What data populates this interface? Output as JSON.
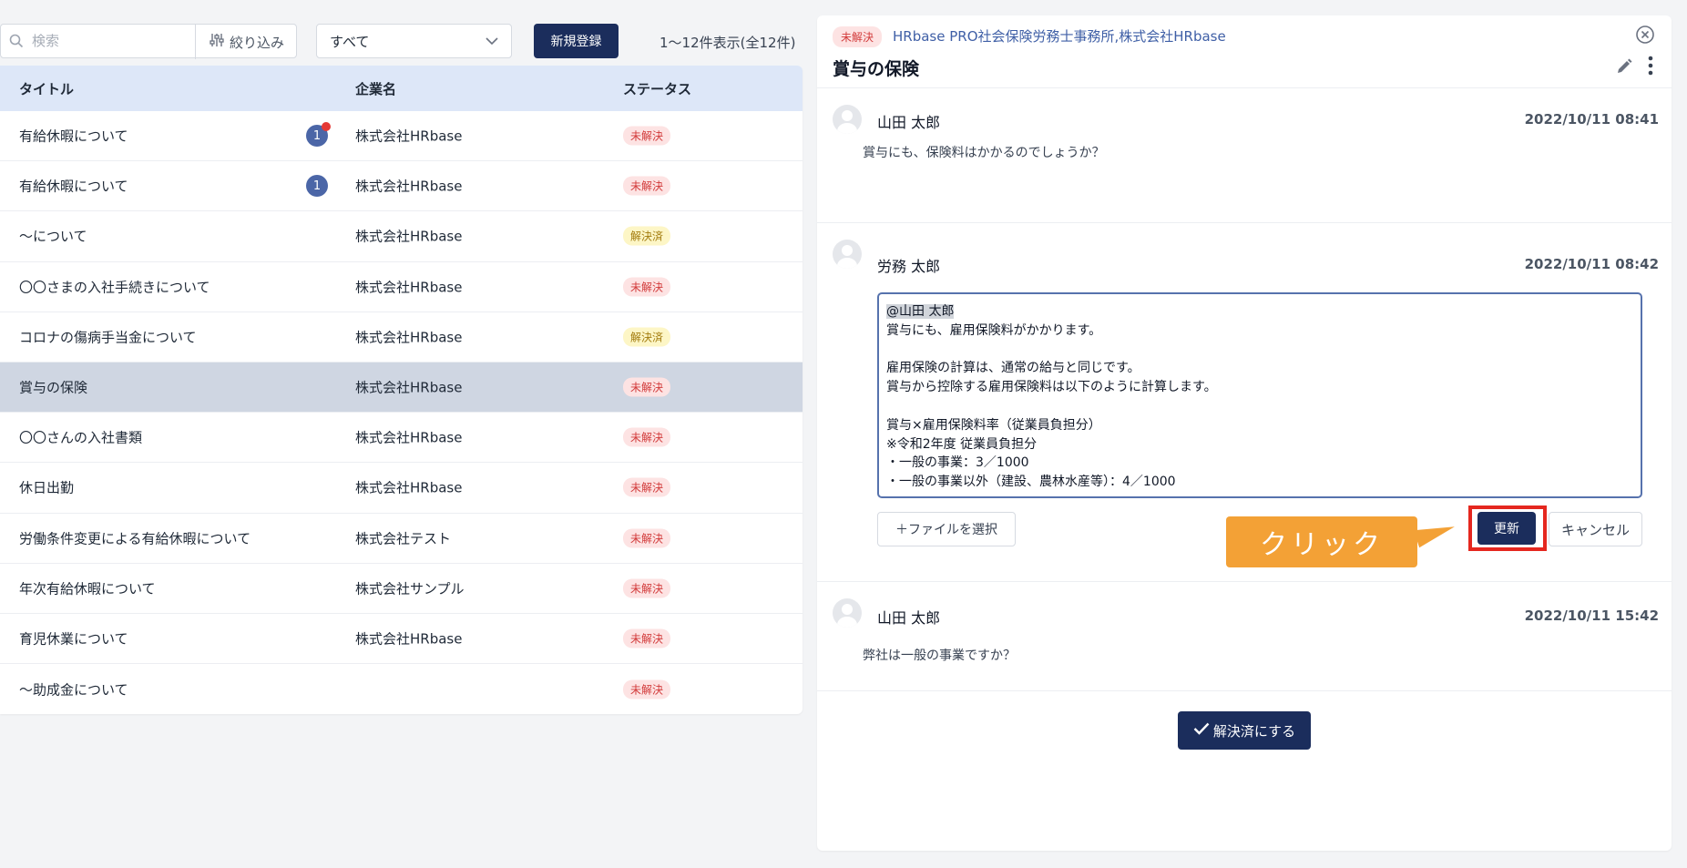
{
  "toolbar": {
    "search_placeholder": "検索",
    "filter_label": "絞り込み",
    "select_value": "すべて",
    "new_label": "新規登録",
    "count_text": "1～12件表示(全12件)"
  },
  "table": {
    "headers": {
      "title": "タイトル",
      "company": "企業名",
      "status": "ステータス"
    },
    "rows": [
      {
        "title": "有給休暇について",
        "company": "株式会社HRbase",
        "status": "未解決",
        "unread": "1",
        "dot": true
      },
      {
        "title": "有給休暇について",
        "company": "株式会社HRbase",
        "status": "未解決",
        "unread": "1",
        "dot": false
      },
      {
        "title": "〜について",
        "company": "株式会社HRbase",
        "status": "解決済"
      },
      {
        "title": "〇〇さまの入社手続きについて",
        "company": "株式会社HRbase",
        "status": "未解決"
      },
      {
        "title": "コロナの傷病手当金について",
        "company": "株式会社HRbase",
        "status": "解決済"
      },
      {
        "title": "賞与の保険",
        "company": "株式会社HRbase",
        "status": "未解決",
        "selected": true
      },
      {
        "title": "〇〇さんの入社書類",
        "company": "株式会社HRbase",
        "status": "未解決"
      },
      {
        "title": "休日出勤",
        "company": "株式会社HRbase",
        "status": "未解決"
      },
      {
        "title": "労働条件変更による有給休暇について",
        "company": "株式会社テスト",
        "status": "未解決"
      },
      {
        "title": "年次有給休暇について",
        "company": "株式会社サンプル",
        "status": "未解決"
      },
      {
        "title": "育児休業について",
        "company": "株式会社HRbase",
        "status": "未解決"
      },
      {
        "title": "〜助成金について",
        "company": "",
        "status": "未解決"
      }
    ]
  },
  "detail": {
    "status": "未解決",
    "org": "HRbase PRO社会保険労務士事務所,株式会社HRbase",
    "title": "賞与の保険",
    "messages": [
      {
        "name": "山田 太郎",
        "time": "2022/10/11 08:41",
        "body": "賞与にも、保険料はかかるのでしょうか？"
      },
      {
        "name": "労務 太郎",
        "time": "2022/10/11 08:42"
      },
      {
        "name": "山田 太郎",
        "time": "2022/10/11 15:42",
        "body": "弊社は一般の事業ですか？"
      }
    ],
    "reply": {
      "mention": "@山田 太郎",
      "lines": [
        "賞与にも、雇用保険料がかかります。",
        "",
        "雇用保険の計算は、通常の給与と同じです。",
        "賞与から控除する雇用保険料は以下のように計算します。",
        "",
        "賞与×雇用保険料率（従業員負担分）",
        "※令和2年度 従業員負担分",
        "・一般の事業：3／1000",
        "・一般の事業以外（建設、農林水産等）：4／1000"
      ]
    },
    "file_label": "＋ファイルを選択",
    "update_label": "更新",
    "cancel_label": "キャンセル",
    "callout_text": "クリック",
    "resolve_label": "解決済にする"
  },
  "colors": {
    "primary": "#1b2d5c",
    "header_bg": "#dde7f8",
    "open_badge": "#d23a3a",
    "done_badge": "#a27b0c",
    "callout": "#f3a136",
    "highlight": "#e5271f"
  }
}
